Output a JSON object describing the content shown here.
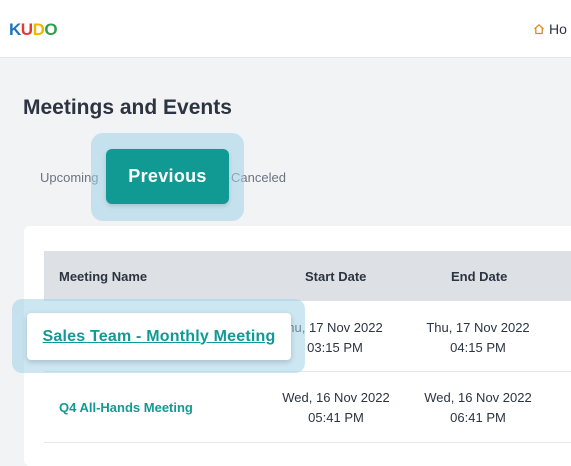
{
  "header": {
    "logo_letters": [
      {
        "char": "K",
        "color": "#1e73be"
      },
      {
        "char": "U",
        "color": "#e53935"
      },
      {
        "char": "D",
        "color": "#f4b400"
      },
      {
        "char": "O",
        "color": "#2e9e4f"
      }
    ],
    "home_label": "Ho"
  },
  "page": {
    "title": "Meetings and Events"
  },
  "tabs": {
    "upcoming": "Upcoming",
    "previous": "Previous",
    "canceled": "Canceled"
  },
  "table": {
    "headers": {
      "name": "Meeting Name",
      "start": "Start Date",
      "end": "End Date"
    },
    "rows": [
      {
        "name": "Sales Team - Monthly Meeting",
        "start_date": "hu, 17 Nov 2022",
        "start_time": "03:15 PM",
        "end_date": "Thu, 17 Nov 2022",
        "end_time": "04:15 PM"
      },
      {
        "name": "Q4 All-Hands Meeting",
        "start_date": "Wed, 16 Nov 2022",
        "start_time": "05:41 PM",
        "end_date": "Wed, 16 Nov 2022",
        "end_time": "06:41 PM"
      }
    ]
  },
  "colors": {
    "accent": "#119a93",
    "highlight": "#a2d2e8"
  }
}
